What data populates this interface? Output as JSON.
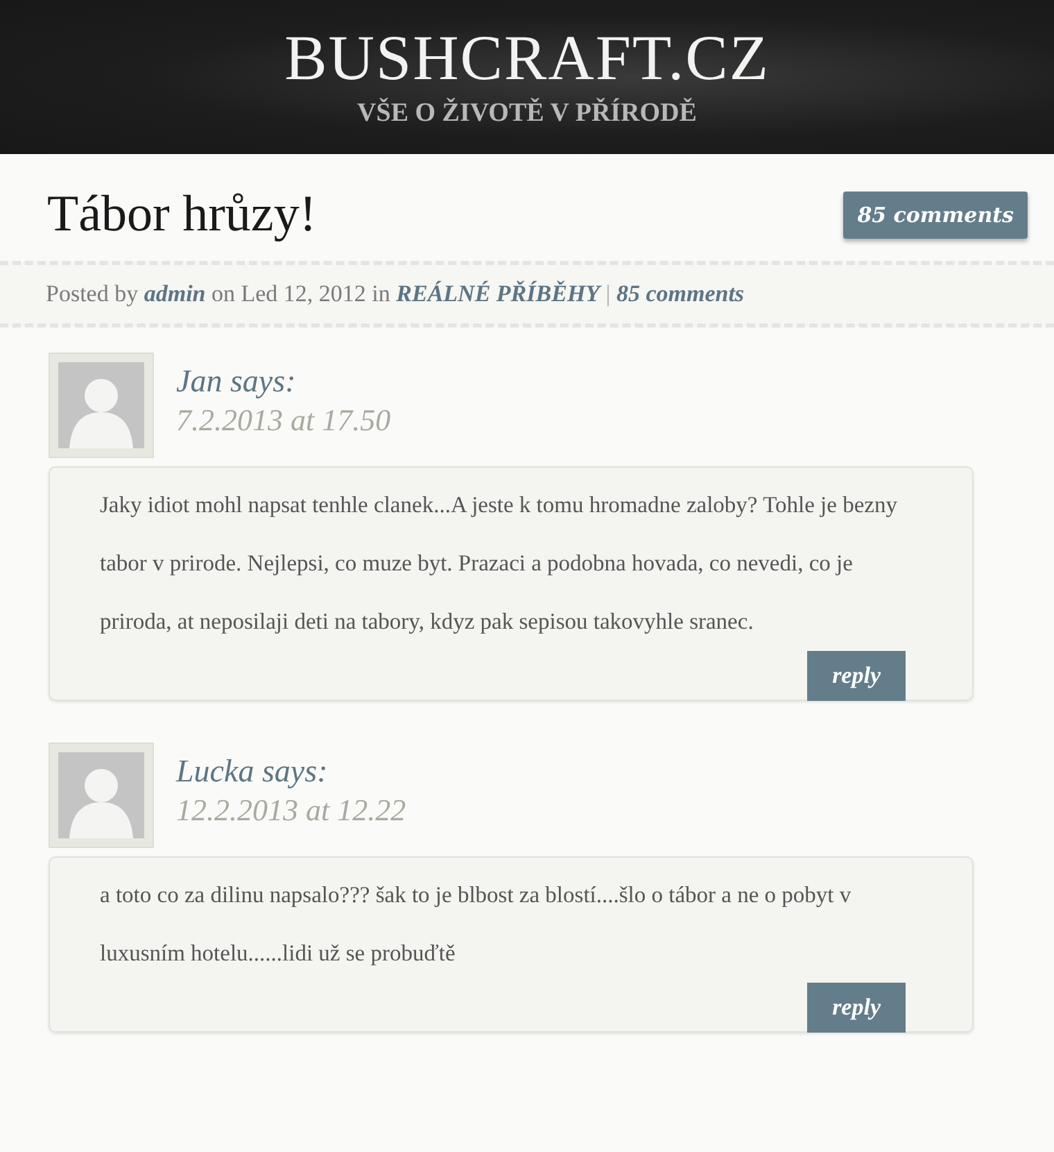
{
  "header": {
    "logo": "BUSHCRAFT.CZ",
    "tagline": "VŠE O ŽIVOTĚ V PŘÍRODĚ"
  },
  "post": {
    "title": "Tábor hrůzy!",
    "comments_badge": "85 comments",
    "meta": [
      {
        "kind": "text",
        "text": "Posted by"
      },
      {
        "kind": "link",
        "text": "admin"
      },
      {
        "kind": "text",
        "text": "on Led 12, 2012 in"
      },
      {
        "kind": "link",
        "text": "REÁLNÉ PŘÍBĚHY"
      },
      {
        "kind": "separator",
        "text": "|"
      },
      {
        "kind": "link",
        "text": "85 comments"
      }
    ]
  },
  "comments": [
    {
      "author": "Jan says:",
      "date": "7.2.2013 at 17.50",
      "text": "Jaky idiot mohl napsat tenhle clanek...A jeste k tomu hromadne zaloby? Tohle je bezny tabor v prirode. Nejlepsi, co muze byt. Prazaci a podobna hovada, co nevedi, co je priroda, at neposilaji deti na tabory, kdyz pak sepisou takovyhle sranec.",
      "reply": "reply"
    },
    {
      "author": "Lucka says:",
      "date": "12.2.2013 at 12.22",
      "text": "a toto co za dilinu napsalo??? šak to je blbost za blostí....šlo o tábor a ne o pobyt v luxusním hotelu......lidi už se probuďtě",
      "reply": "reply"
    }
  ]
}
